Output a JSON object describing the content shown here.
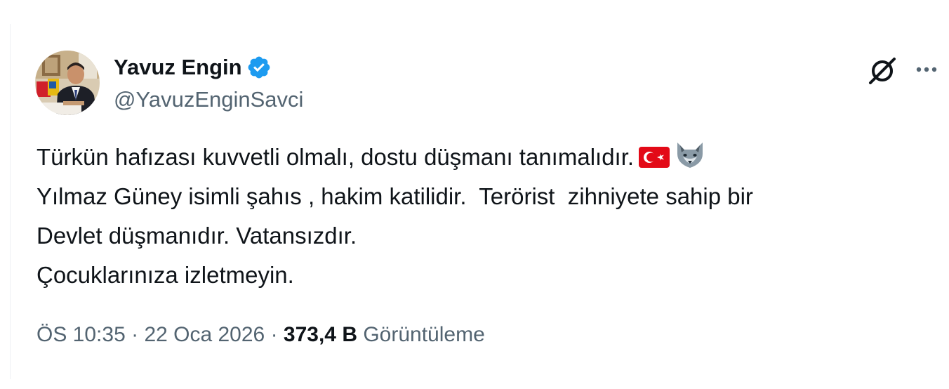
{
  "author": {
    "display_name": "Yavuz Engin",
    "handle": "@YavuzEnginSavci",
    "verified": true,
    "verified_color": "#1d9bf0"
  },
  "tweet": {
    "lines": [
      "Türkün hafızası kuvvetli olmalı, dostu düşmanı tanımalıdır.",
      "Yılmaz Güney isimli şahıs , hakim katilidir.  Terörist  zihniyete sahip bir",
      "Devlet düşmanıdır. Vatansızdır.",
      "Çocuklarınıza izletmeyin."
    ],
    "emojis": [
      "turkey-flag",
      "wolf"
    ]
  },
  "meta": {
    "time": "ÖS 10:35",
    "separator": " · ",
    "date": "22 Oca 2026",
    "views_count": "373,4 B",
    "views_label": "Görüntüleme"
  },
  "icons": {
    "grok": "grok-icon",
    "more": "more-icon"
  },
  "colors": {
    "text_primary": "#0f1419",
    "text_secondary": "#536471",
    "flag_red": "#e30a17"
  }
}
